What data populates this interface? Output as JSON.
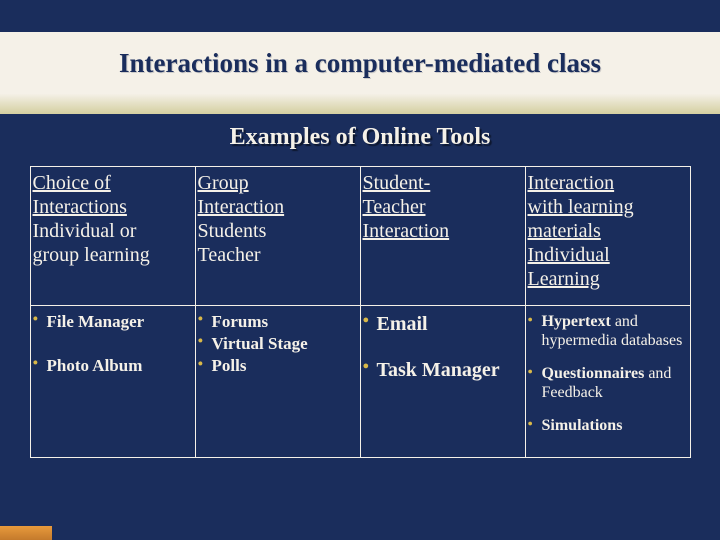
{
  "title": "Interactions in a computer-mediated class",
  "subtitle": "Examples of Online Tools",
  "columns": [
    {
      "header": {
        "line1": "Choice of",
        "line2": " Interactions",
        "line3": "Individual or",
        "line4": " group learning"
      },
      "items": [
        {
          "label": "File Manager",
          "tail": ""
        },
        {
          "label": "Photo Album",
          "tail": ""
        }
      ]
    },
    {
      "header": {
        "line1": "Group",
        "line2": " Interaction",
        "line3": "Students",
        "line4": " Teacher"
      },
      "items": [
        {
          "label": "Forums",
          "tail": ""
        },
        {
          "label": "Virtual Stage",
          "tail": ""
        },
        {
          "label": "Polls",
          "tail": ""
        }
      ]
    },
    {
      "header": {
        "line1": " Student-",
        "line2": "Teacher",
        "line3": " Interaction",
        "line4": ""
      },
      "items": [
        {
          "label": "Email",
          "tail": ""
        },
        {
          "label": "Task Manager",
          "tail": ""
        }
      ]
    },
    {
      "header": {
        "line1": "Interaction",
        "line2": "with learning",
        "line3": " materials",
        "line4": "Individual",
        "line5": " Learning"
      },
      "items": [
        {
          "label": "Hypertext",
          "tail": " and hypermedia databases"
        },
        {
          "label": "Questionnaires",
          "tail": " and Feedback"
        },
        {
          "label": "Simulations",
          "tail": ""
        }
      ]
    }
  ]
}
